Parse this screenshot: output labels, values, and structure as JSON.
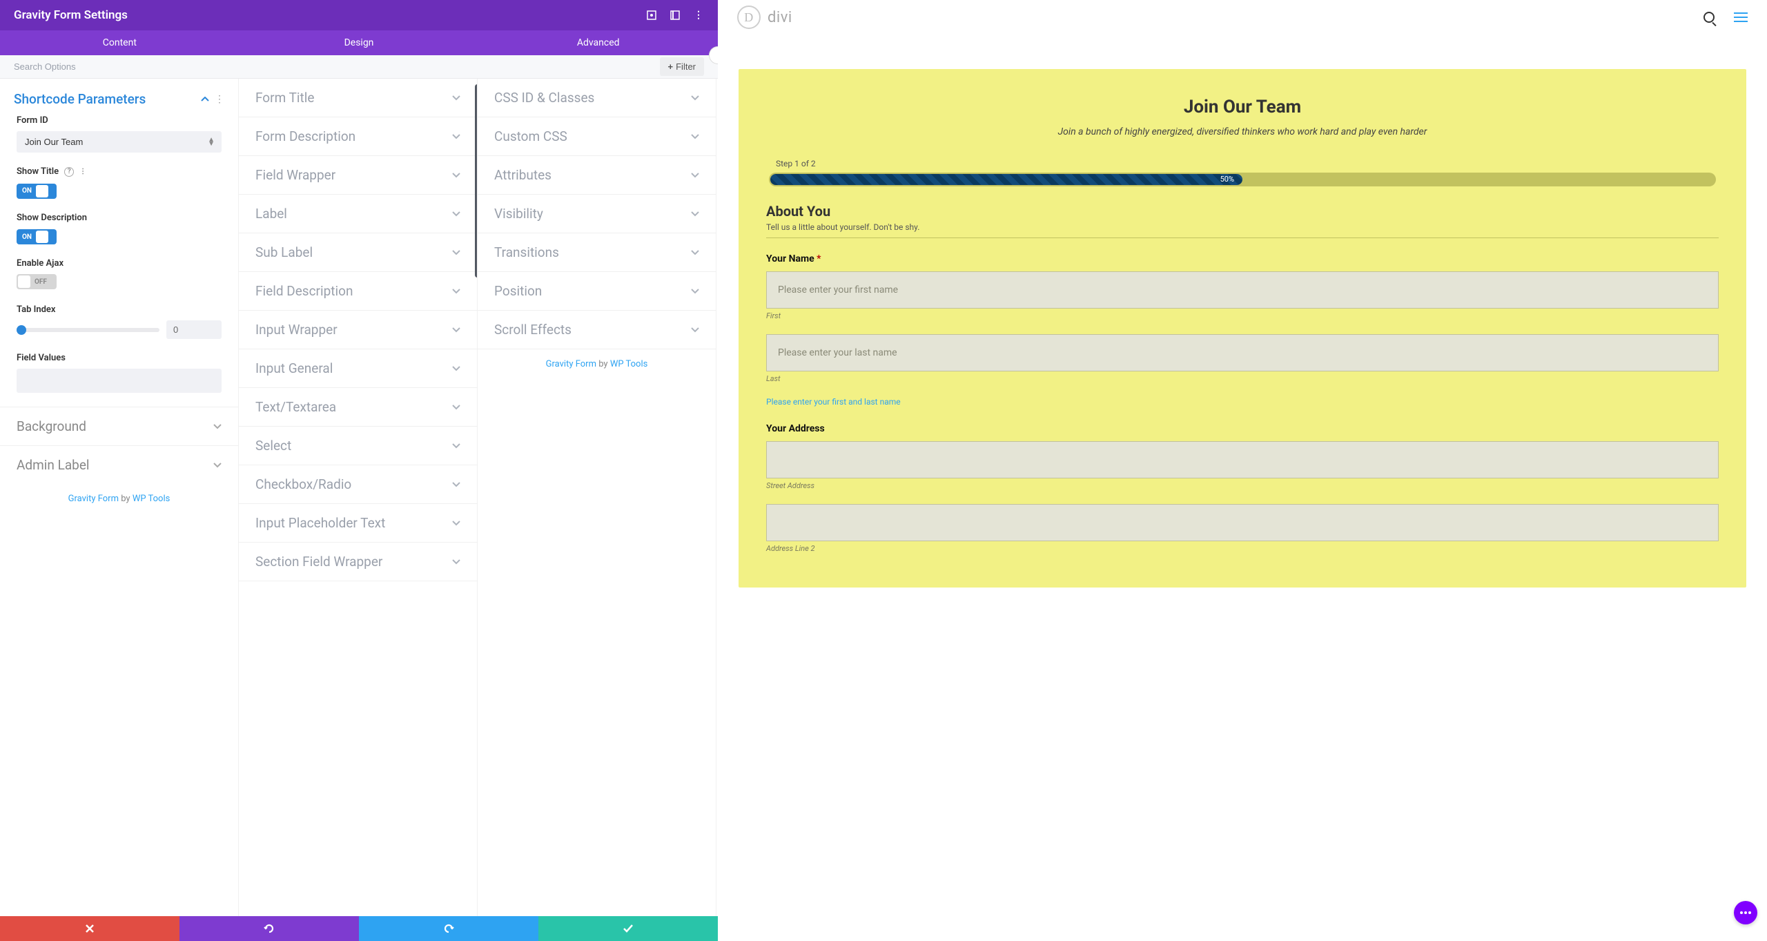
{
  "header": {
    "title": "Gravity Form Settings"
  },
  "tabs": [
    "Content",
    "Design",
    "Advanced"
  ],
  "search": {
    "placeholder": "Search Options",
    "filter_label": "Filter"
  },
  "col1": {
    "section_title": "Shortcode Parameters",
    "form_id_label": "Form ID",
    "form_id_value": "Join Our Team",
    "show_title_label": "Show Title",
    "show_title_state": "ON",
    "show_desc_label": "Show Description",
    "show_desc_state": "ON",
    "enable_ajax_label": "Enable Ajax",
    "enable_ajax_state": "OFF",
    "tab_index_label": "Tab Index",
    "tab_index_value": "0",
    "field_values_label": "Field Values",
    "background_label": "Background",
    "admin_label_label": "Admin Label",
    "credit_a": "Gravity Form",
    "credit_by": " by ",
    "credit_b": "WP Tools"
  },
  "col2": [
    "Form Title",
    "Form Description",
    "Field Wrapper",
    "Label",
    "Sub Label",
    "Field Description",
    "Input Wrapper",
    "Input General",
    "Text/Textarea",
    "Select",
    "Checkbox/Radio",
    "Input Placeholder Text",
    "Section Field Wrapper"
  ],
  "col3": [
    "CSS ID & Classes",
    "Custom CSS",
    "Attributes",
    "Visibility",
    "Transitions",
    "Position",
    "Scroll Effects"
  ],
  "credit2": {
    "a": "Gravity Form",
    "by": " by ",
    "b": "WP Tools"
  },
  "preview": {
    "brand": "divi",
    "form": {
      "title": "Join Our Team",
      "subtitle": "Join a bunch of highly energized, diversified thinkers who work hard and play even harder",
      "step": "Step 1 of 2",
      "progress": "50%",
      "sec_title": "About You",
      "sec_desc": "Tell us a little about yourself. Don't be shy.",
      "name_label": "Your Name ",
      "first_ph": "Please enter your first name",
      "first_sub": "First",
      "last_ph": "Please enter your last name",
      "last_sub": "Last",
      "name_help": "Please enter your first and last name",
      "addr_label": "Your Address",
      "street_sub": "Street Address",
      "line2_sub": "Address Line 2"
    }
  }
}
